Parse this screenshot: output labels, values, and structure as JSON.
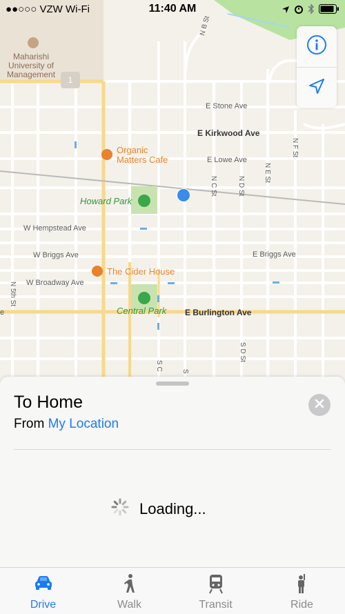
{
  "status_bar": {
    "carrier": "●●○○○ VZW Wi-Fi",
    "time": "11:40 AM"
  },
  "map": {
    "streets": {
      "n_b_st": "N B St",
      "e_stone_ave": "E Stone Ave",
      "e_kirkwood_ave": "E Kirkwood Ave",
      "e_lowe_ave": "E Lowe Ave",
      "n_c_st": "N C St",
      "n_d_st": "N D St",
      "n_e_st": "N E St",
      "n_f_st": "N F St",
      "w_hempstead_ave": "W Hempstead Ave",
      "w_briggs_ave": "W Briggs Ave",
      "e_briggs_ave": "E Briggs Ave",
      "w_broadway_ave": "W Broadway Ave",
      "n_5th_st": "N 5th St",
      "e_burlington_ave": "E Burlington Ave",
      "s_d_st": "S D St",
      "s_c": "S C",
      "s_partial": "S",
      "left_e": "e"
    },
    "pois": {
      "campus": "Maharishi\nUniversity of\nManagement",
      "campus_sub": "Maharishi",
      "route_shield": "1",
      "organic_matters": "Organic\nMatters Cafe",
      "howard_park": "Howard Park",
      "cider_house": "The Cider House",
      "central_park": "Central Park"
    },
    "colors": {
      "background": "#f4f1ea",
      "road": "#ffffff",
      "major_road": "#f7d98b",
      "park": "#c9e3b0",
      "water_green": "#b8e2a0",
      "poi_orange": "#e8822c",
      "poi_green": "#2e9a3a"
    }
  },
  "map_controls": {
    "info_icon": "info-icon",
    "location_icon": "location-arrow-icon"
  },
  "sheet": {
    "title": "To Home",
    "from_prefix": "From",
    "from_link": "My Location",
    "loading": "Loading..."
  },
  "tabs": [
    {
      "label": "Drive",
      "icon": "car-icon",
      "active": true
    },
    {
      "label": "Walk",
      "icon": "walk-icon",
      "active": false
    },
    {
      "label": "Transit",
      "icon": "train-icon",
      "active": false
    },
    {
      "label": "Ride",
      "icon": "ride-icon",
      "active": false
    }
  ],
  "accent_color": "#1a7bf3"
}
